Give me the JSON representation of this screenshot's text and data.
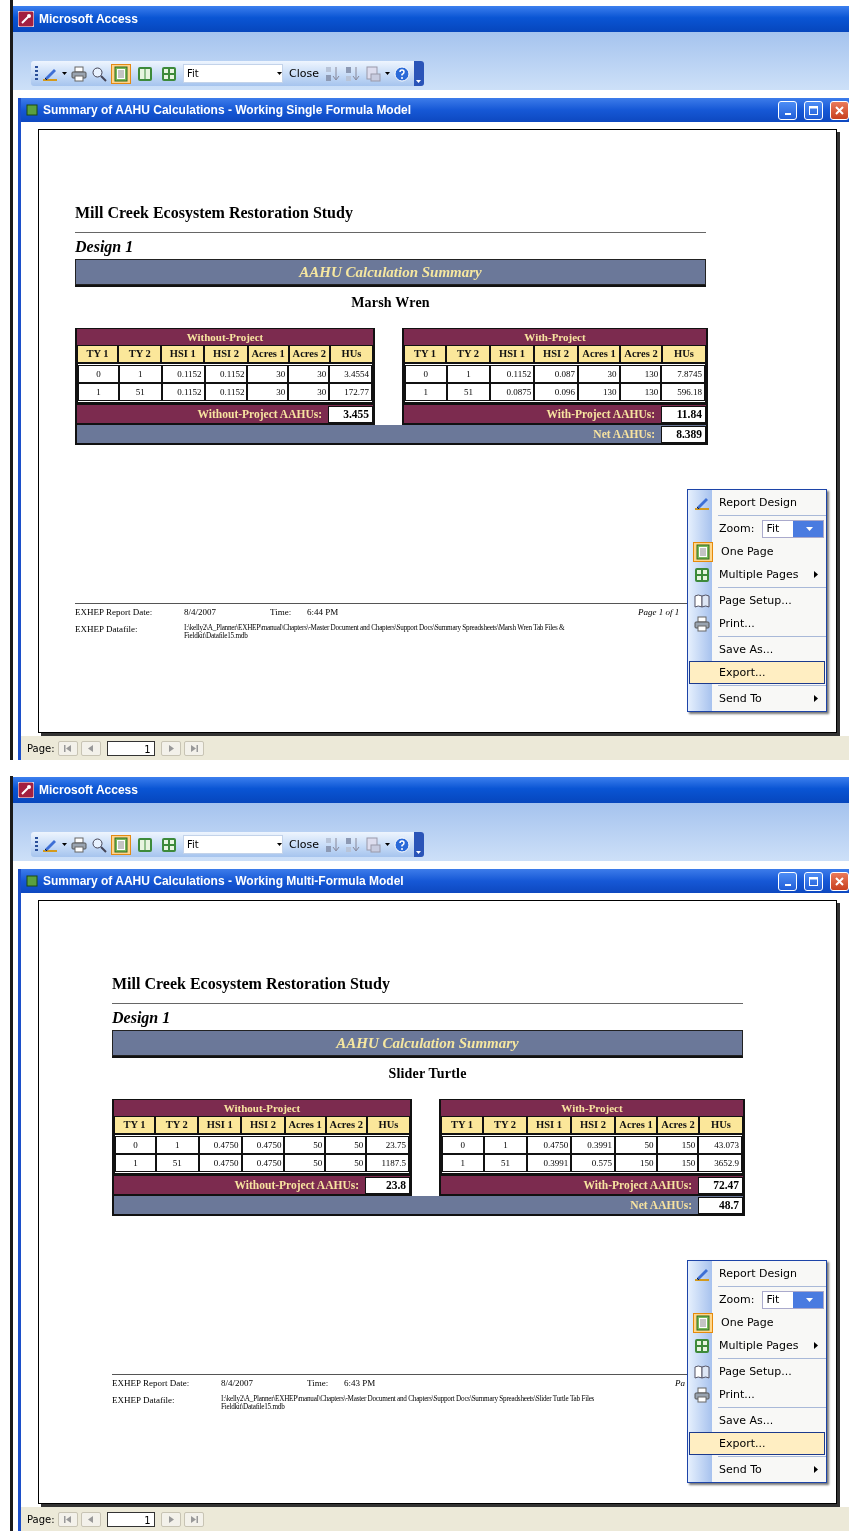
{
  "windows": [
    {
      "app_title": "Microsoft Access",
      "toolbar": {
        "zoom_value": "Fit",
        "close_label": "Close",
        "view_buttons": [
          {
            "kind": "onepage",
            "selected": true
          },
          {
            "kind": "twopage",
            "selected": false
          },
          {
            "kind": "multipage",
            "selected": false
          }
        ]
      },
      "report_window": {
        "title": "Summary of AAHU Calculations - Working Single Formula Model",
        "report": {
          "study_title": "Mill Creek Ecosystem Restoration Study",
          "design": "Design 1",
          "banner": "AAHU Calculation Summary",
          "species": "Marsh Wren",
          "without_project": {
            "title": "Without-Project",
            "columns": [
              "TY 1",
              "TY 2",
              "HSI 1",
              "HSI 2",
              "Acres 1",
              "Acres 2",
              "HUs"
            ],
            "rows": [
              [
                "0",
                "1",
                "0.1152",
                "0.1152",
                "30",
                "30",
                "3.4554"
              ],
              [
                "1",
                "51",
                "0.1152",
                "0.1152",
                "30",
                "30",
                "172.77"
              ]
            ],
            "total_label": "Without-Project AAHUs:",
            "total_value": "3.455"
          },
          "with_project": {
            "title": "With-Project",
            "columns": [
              "TY 1",
              "TY 2",
              "HSI 1",
              "HSI 2",
              "Acres 1",
              "Acres 2",
              "HUs"
            ],
            "rows": [
              [
                "0",
                "1",
                "0.1152",
                "0.087",
                "30",
                "130",
                "7.8745"
              ],
              [
                "1",
                "51",
                "0.0875",
                "0.096",
                "130",
                "130",
                "596.18"
              ]
            ],
            "total_label": "With-Project AAHUs:",
            "total_value": "11.84"
          },
          "net_label": "Net AAHUs:",
          "net_value": "8.389",
          "footer": {
            "date_label": "EXHEP Report Date:",
            "date": "8/4/2007",
            "time_label": "Time:",
            "time": "6:44 PM",
            "page": "Page 1 of 1",
            "datafile_label": "EXHEP Datafile:",
            "datafile_lines": [
              "I:\\kelly2\\A_Planner\\EXHEP\\manual\\Chapters\\-Master Document and Chapters\\Support Docs\\Summary Spreadsheets\\Marsh Wren Tab Files &",
              "Fieldkit\\Datafile15.mdb"
            ]
          }
        },
        "context_menu": {
          "groups": [
            [
              {
                "kind": "design",
                "label": "Report Design",
                "selected": false
              }
            ],
            [
              {
                "kind": "zoom",
                "label": "Zoom:",
                "value": "Fit",
                "selected": false
              },
              {
                "kind": "onepage",
                "label": "One Page",
                "selected": false
              },
              {
                "kind": "multipage",
                "label": "Multiple Pages",
                "selected": false
              }
            ],
            [
              {
                "kind": "setup",
                "label": "Page Setup...",
                "selected": false
              },
              {
                "kind": "print",
                "label": "Print...",
                "selected": false
              }
            ],
            [
              {
                "kind": "saveas",
                "label": "Save As...",
                "selected": false
              },
              {
                "kind": "export",
                "label": "Export...",
                "selected": true
              }
            ],
            [
              {
                "kind": "sendto",
                "label": "Send To",
                "selected": false
              }
            ]
          ]
        },
        "navigation": {
          "label": "Page:",
          "page": "1"
        }
      }
    },
    {
      "app_title": "Microsoft Access",
      "toolbar": {
        "zoom_value": "Fit",
        "close_label": "Close",
        "view_buttons": [
          {
            "kind": "onepage",
            "selected": true
          },
          {
            "kind": "twopage",
            "selected": false
          },
          {
            "kind": "multipage",
            "selected": false
          }
        ]
      },
      "report_window": {
        "title": "Summary of AAHU Calculations - Working Multi-Formula Model",
        "report": {
          "study_title": "Mill Creek Ecosystem Restoration Study",
          "design": "Design 1",
          "banner": "AAHU Calculation Summary",
          "species": "Slider Turtle",
          "without_project": {
            "title": "Without-Project",
            "columns": [
              "TY 1",
              "TY 2",
              "HSI 1",
              "HSI 2",
              "Acres 1",
              "Acres 2",
              "HUs"
            ],
            "rows": [
              [
                "0",
                "1",
                "0.4750",
                "0.4750",
                "50",
                "50",
                "23.75"
              ],
              [
                "1",
                "51",
                "0.4750",
                "0.4750",
                "50",
                "50",
                "1187.5"
              ]
            ],
            "total_label": "Without-Project AAHUs:",
            "total_value": "23.8"
          },
          "with_project": {
            "title": "With-Project",
            "columns": [
              "TY 1",
              "TY 2",
              "HSI 1",
              "HSI 2",
              "Acres 1",
              "Acres 2",
              "HUs"
            ],
            "rows": [
              [
                "0",
                "1",
                "0.4750",
                "0.3991",
                "50",
                "150",
                "43.073"
              ],
              [
                "1",
                "51",
                "0.3991",
                "0.575",
                "150",
                "150",
                "3652.9"
              ]
            ],
            "total_label": "With-Project AAHUs:",
            "total_value": "72.47"
          },
          "net_label": "Net AAHUs:",
          "net_value": "48.7",
          "footer": {
            "date_label": "EXHEP Report Date:",
            "date": "8/4/2007",
            "time_label": "Time:",
            "time": "6:43 PM",
            "page": "Pa",
            "datafile_label": "EXHEP Datafile:",
            "datafile_lines": [
              "I:\\kelly2\\A_Planner\\EXHEP\\manual\\Chapters\\-Master Document and Chapters\\Support Docs\\Summary Spreadsheets\\Slider Turtle Tab Files",
              "Fieldkit\\Datafile15.mdb"
            ]
          }
        },
        "context_menu": {
          "groups": [
            [
              {
                "kind": "design",
                "label": "Report Design",
                "selected": false
              }
            ],
            [
              {
                "kind": "zoom",
                "label": "Zoom:",
                "value": "Fit",
                "selected": false
              },
              {
                "kind": "onepage",
                "label": "One Page",
                "selected": false
              },
              {
                "kind": "multipage",
                "label": "Multiple Pages",
                "selected": false
              }
            ],
            [
              {
                "kind": "setup",
                "label": "Page Setup...",
                "selected": false
              },
              {
                "kind": "print",
                "label": "Print...",
                "selected": false
              }
            ],
            [
              {
                "kind": "saveas",
                "label": "Save As...",
                "selected": false
              },
              {
                "kind": "export",
                "label": "Export...",
                "selected": true
              }
            ],
            [
              {
                "kind": "sendto",
                "label": "Send To",
                "selected": false
              }
            ]
          ]
        },
        "navigation": {
          "label": "Page:",
          "page": "1"
        }
      }
    }
  ]
}
